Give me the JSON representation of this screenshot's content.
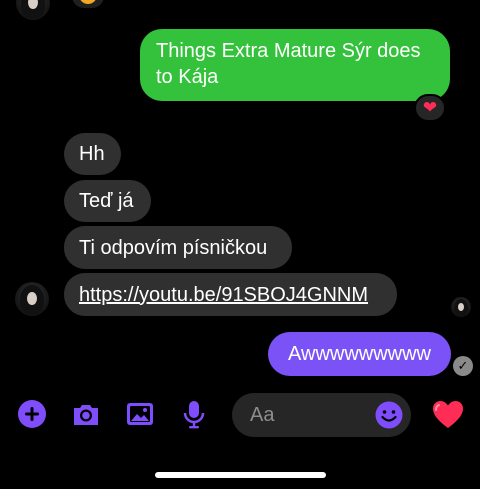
{
  "messages": {
    "sent_green": "Things Extra Mature Sýr does to Kája",
    "sent_green_reaction": "❤",
    "received": [
      {
        "text": "Hh"
      },
      {
        "text": "Teď já"
      },
      {
        "text": "Ti odpovím písničkou"
      },
      {
        "text": "https://youtu.be/91SBOJ4GNNM"
      }
    ],
    "sent_purple": "Awwwwwwwww"
  },
  "composer": {
    "placeholder": "Aa"
  },
  "colors": {
    "green_bubble": "#34c23c",
    "purple_bubble": "#7b52f6",
    "gray_bubble": "#303030",
    "accent": "#7f4dfb",
    "heart": "#ff2d55"
  },
  "icons": {
    "toolbar": [
      "plus-icon",
      "camera-icon",
      "image-icon",
      "microphone-icon"
    ],
    "emoji": "emoji-icon",
    "send": "heart-icon",
    "read_receipt": "checkmark-icon"
  }
}
